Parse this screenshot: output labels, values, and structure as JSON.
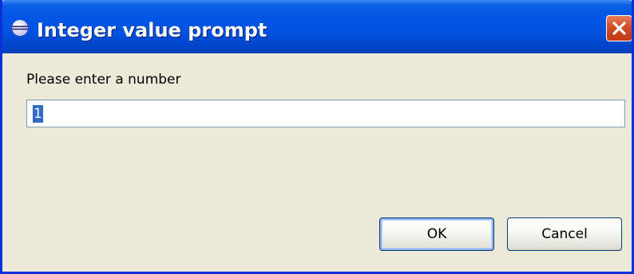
{
  "window": {
    "title": "Integer value prompt",
    "icon": "eclipse-icon",
    "close_icon": "close-icon"
  },
  "dialog": {
    "prompt_label": "Please enter a number",
    "input_value": "1",
    "ok_label": "OK",
    "cancel_label": "Cancel"
  },
  "colors": {
    "titlebar": "#0152e0",
    "close_button": "#d24c26",
    "dialog_background": "#ece9d8",
    "selection": "#316ac5",
    "input_border": "#7f9db9"
  }
}
